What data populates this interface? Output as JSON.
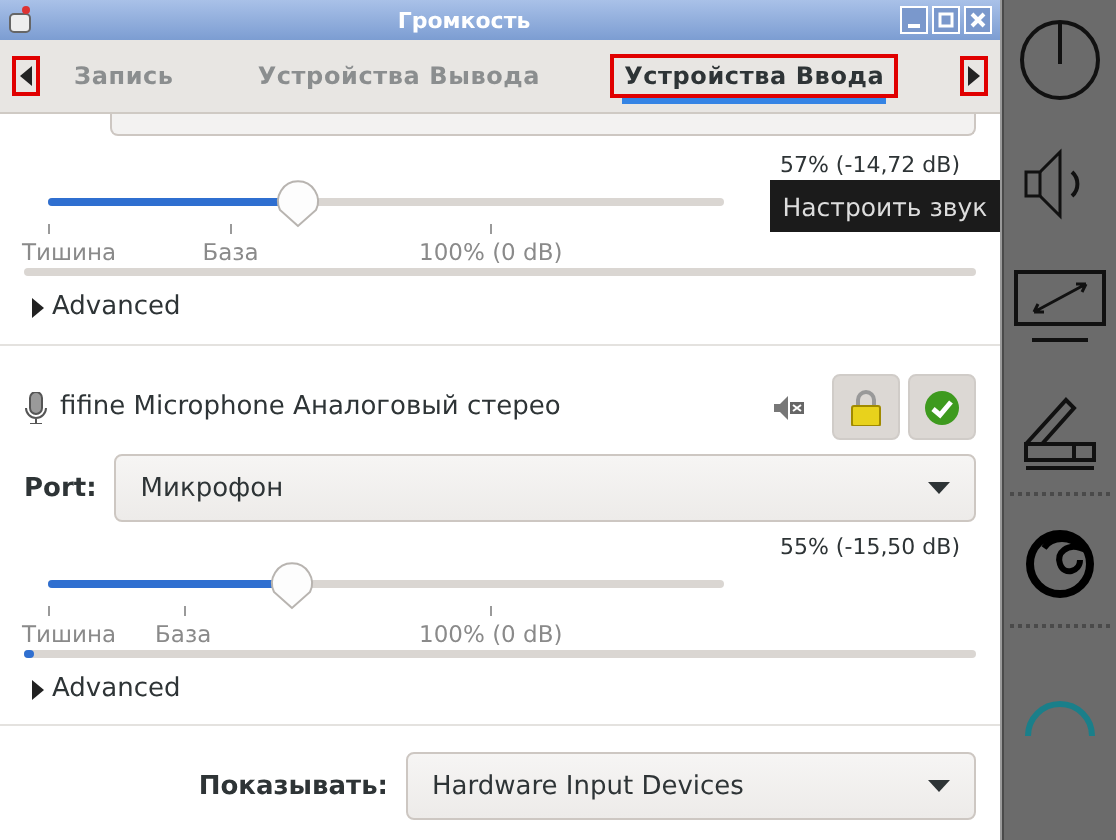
{
  "window": {
    "title": "Громкость"
  },
  "tab_scroll_buttons": [
    {
      "kind": "left",
      "highlighted": true
    },
    {
      "kind": "right",
      "highlighted": true
    }
  ],
  "tabs": [
    {
      "label": "Запись",
      "selected": false,
      "highlighted": false
    },
    {
      "label": "Устройства Вывода",
      "selected": false,
      "highlighted": false
    },
    {
      "label": "Устройства Ввода",
      "selected": true,
      "highlighted": true
    }
  ],
  "upper_device": {
    "reading": "57% (-14,72 dB)",
    "level": 0.37,
    "ticks": [
      "Тишина",
      "База",
      "100% (0 dB)"
    ],
    "meter": {
      "level": 0
    },
    "advanced": "Advanced"
  },
  "device": {
    "name": "fifine Microphone Аналоговый стерео",
    "port_label": "Port:",
    "port": "Микрофон",
    "reading": "55% (-15,50 dB)",
    "level": 0.36,
    "ticks": [
      "Тишина",
      "База",
      "100% (0 dB)"
    ],
    "meter": {
      "level": 0.01
    },
    "advanced": "Advanced"
  },
  "footer": {
    "label": "Показывать:",
    "value": "Hardware Input Devices"
  },
  "tooltip": {
    "text": "Настроить звук"
  }
}
